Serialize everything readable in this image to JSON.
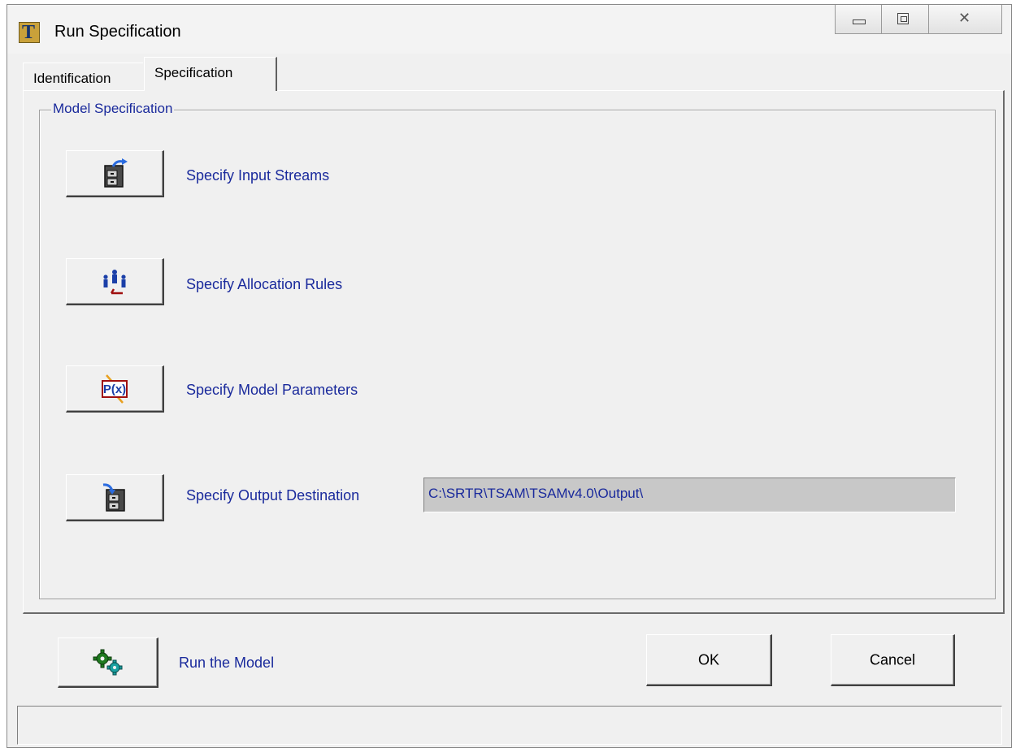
{
  "window": {
    "title": "Run Specification",
    "app_icon_letter": "T"
  },
  "tabs": [
    {
      "label": "Identification",
      "active": false
    },
    {
      "label": "Specification",
      "active": true
    }
  ],
  "model_specification": {
    "legend": "Model Specification",
    "items": [
      {
        "label": "Specify Input Streams",
        "icon": "cabinet-in-icon"
      },
      {
        "label": "Specify Allocation Rules",
        "icon": "people-allocation-icon"
      },
      {
        "label": "Specify Model Parameters",
        "icon": "parameters-px-icon"
      },
      {
        "label": "Specify Output Destination",
        "icon": "cabinet-out-icon"
      }
    ],
    "output_path": "C:\\SRTR\\TSAM\\TSAMv4.0\\Output\\"
  },
  "footer": {
    "run_label": "Run the Model",
    "run_icon": "gears-icon",
    "ok_label": "OK",
    "cancel_label": "Cancel"
  },
  "colors": {
    "label_blue": "#1a2a9c",
    "background": "#f0f0f0",
    "field_gray": "#c8c8c8"
  }
}
